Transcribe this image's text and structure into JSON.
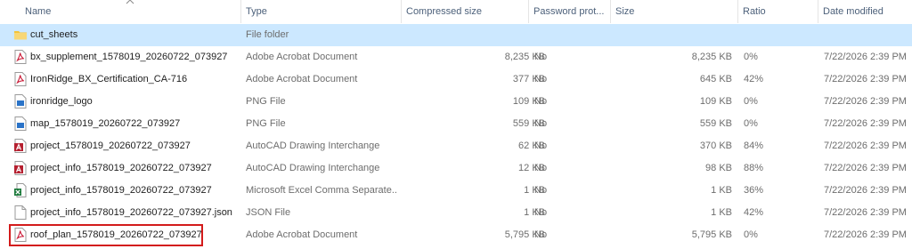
{
  "columns": {
    "name": "Name",
    "type": "Type",
    "compressed_size": "Compressed size",
    "password_protected": "Password prot...",
    "size": "Size",
    "ratio": "Ratio",
    "date_modified": "Date modified"
  },
  "rows": [
    {
      "name": "cut_sheets",
      "type": "File folder",
      "compressed": "",
      "password": "",
      "size": "",
      "ratio": "",
      "date": "",
      "icon": "folder-icon"
    },
    {
      "name": "bx_supplement_1578019_20260722_073927",
      "type": "Adobe Acrobat Document",
      "compressed": "8,235 KB",
      "password": "No",
      "size": "8,235 KB",
      "ratio": "0%",
      "date": "7/22/2026 2:39 PM",
      "icon": "pdf-icon"
    },
    {
      "name": "IronRidge_BX_Certification_CA-716",
      "type": "Adobe Acrobat Document",
      "compressed": "377 KB",
      "password": "No",
      "size": "645 KB",
      "ratio": "42%",
      "date": "7/22/2026 2:39 PM",
      "icon": "pdf-icon"
    },
    {
      "name": "ironridge_logo",
      "type": "PNG File",
      "compressed": "109 KB",
      "password": "No",
      "size": "109 KB",
      "ratio": "0%",
      "date": "7/22/2026 2:39 PM",
      "icon": "png-icon"
    },
    {
      "name": "map_1578019_20260722_073927",
      "type": "PNG File",
      "compressed": "559 KB",
      "password": "No",
      "size": "559 KB",
      "ratio": "0%",
      "date": "7/22/2026 2:39 PM",
      "icon": "png-icon"
    },
    {
      "name": "project_1578019_20260722_073927",
      "type": "AutoCAD Drawing Interchange",
      "compressed": "62 KB",
      "password": "No",
      "size": "370 KB",
      "ratio": "84%",
      "date": "7/22/2026 2:39 PM",
      "icon": "autocad-icon"
    },
    {
      "name": "project_info_1578019_20260722_073927",
      "type": "AutoCAD Drawing Interchange",
      "compressed": "12 KB",
      "password": "No",
      "size": "98 KB",
      "ratio": "88%",
      "date": "7/22/2026 2:39 PM",
      "icon": "autocad-icon"
    },
    {
      "name": "project_info_1578019_20260722_073927",
      "type": "Microsoft Excel Comma Separate...",
      "compressed": "1 KB",
      "password": "No",
      "size": "1 KB",
      "ratio": "36%",
      "date": "7/22/2026 2:39 PM",
      "icon": "excel-csv-icon"
    },
    {
      "name": "project_info_1578019_20260722_073927.json",
      "type": "JSON File",
      "compressed": "1 KB",
      "password": "No",
      "size": "1 KB",
      "ratio": "42%",
      "date": "7/22/2026 2:39 PM",
      "icon": "json-file-icon"
    },
    {
      "name": "roof_plan_1578019_20260722_073927",
      "type": "Adobe Acrobat Document",
      "compressed": "5,795 KB",
      "password": "No",
      "size": "5,795 KB",
      "ratio": "0%",
      "date": "7/22/2026 2:39 PM",
      "icon": "pdf-icon"
    }
  ],
  "selected_row": 0,
  "focused_row": 9,
  "colors": {
    "selected": "#cce8ff",
    "header_text": "#4c607a",
    "focus_border": "#d31b1b",
    "pdf_red": "#c8102e",
    "folder_yellow": "#f3c43a",
    "png_blue": "#2a73c8",
    "autocad_red": "#b51f2f",
    "excel_green": "#1d7a3c"
  }
}
